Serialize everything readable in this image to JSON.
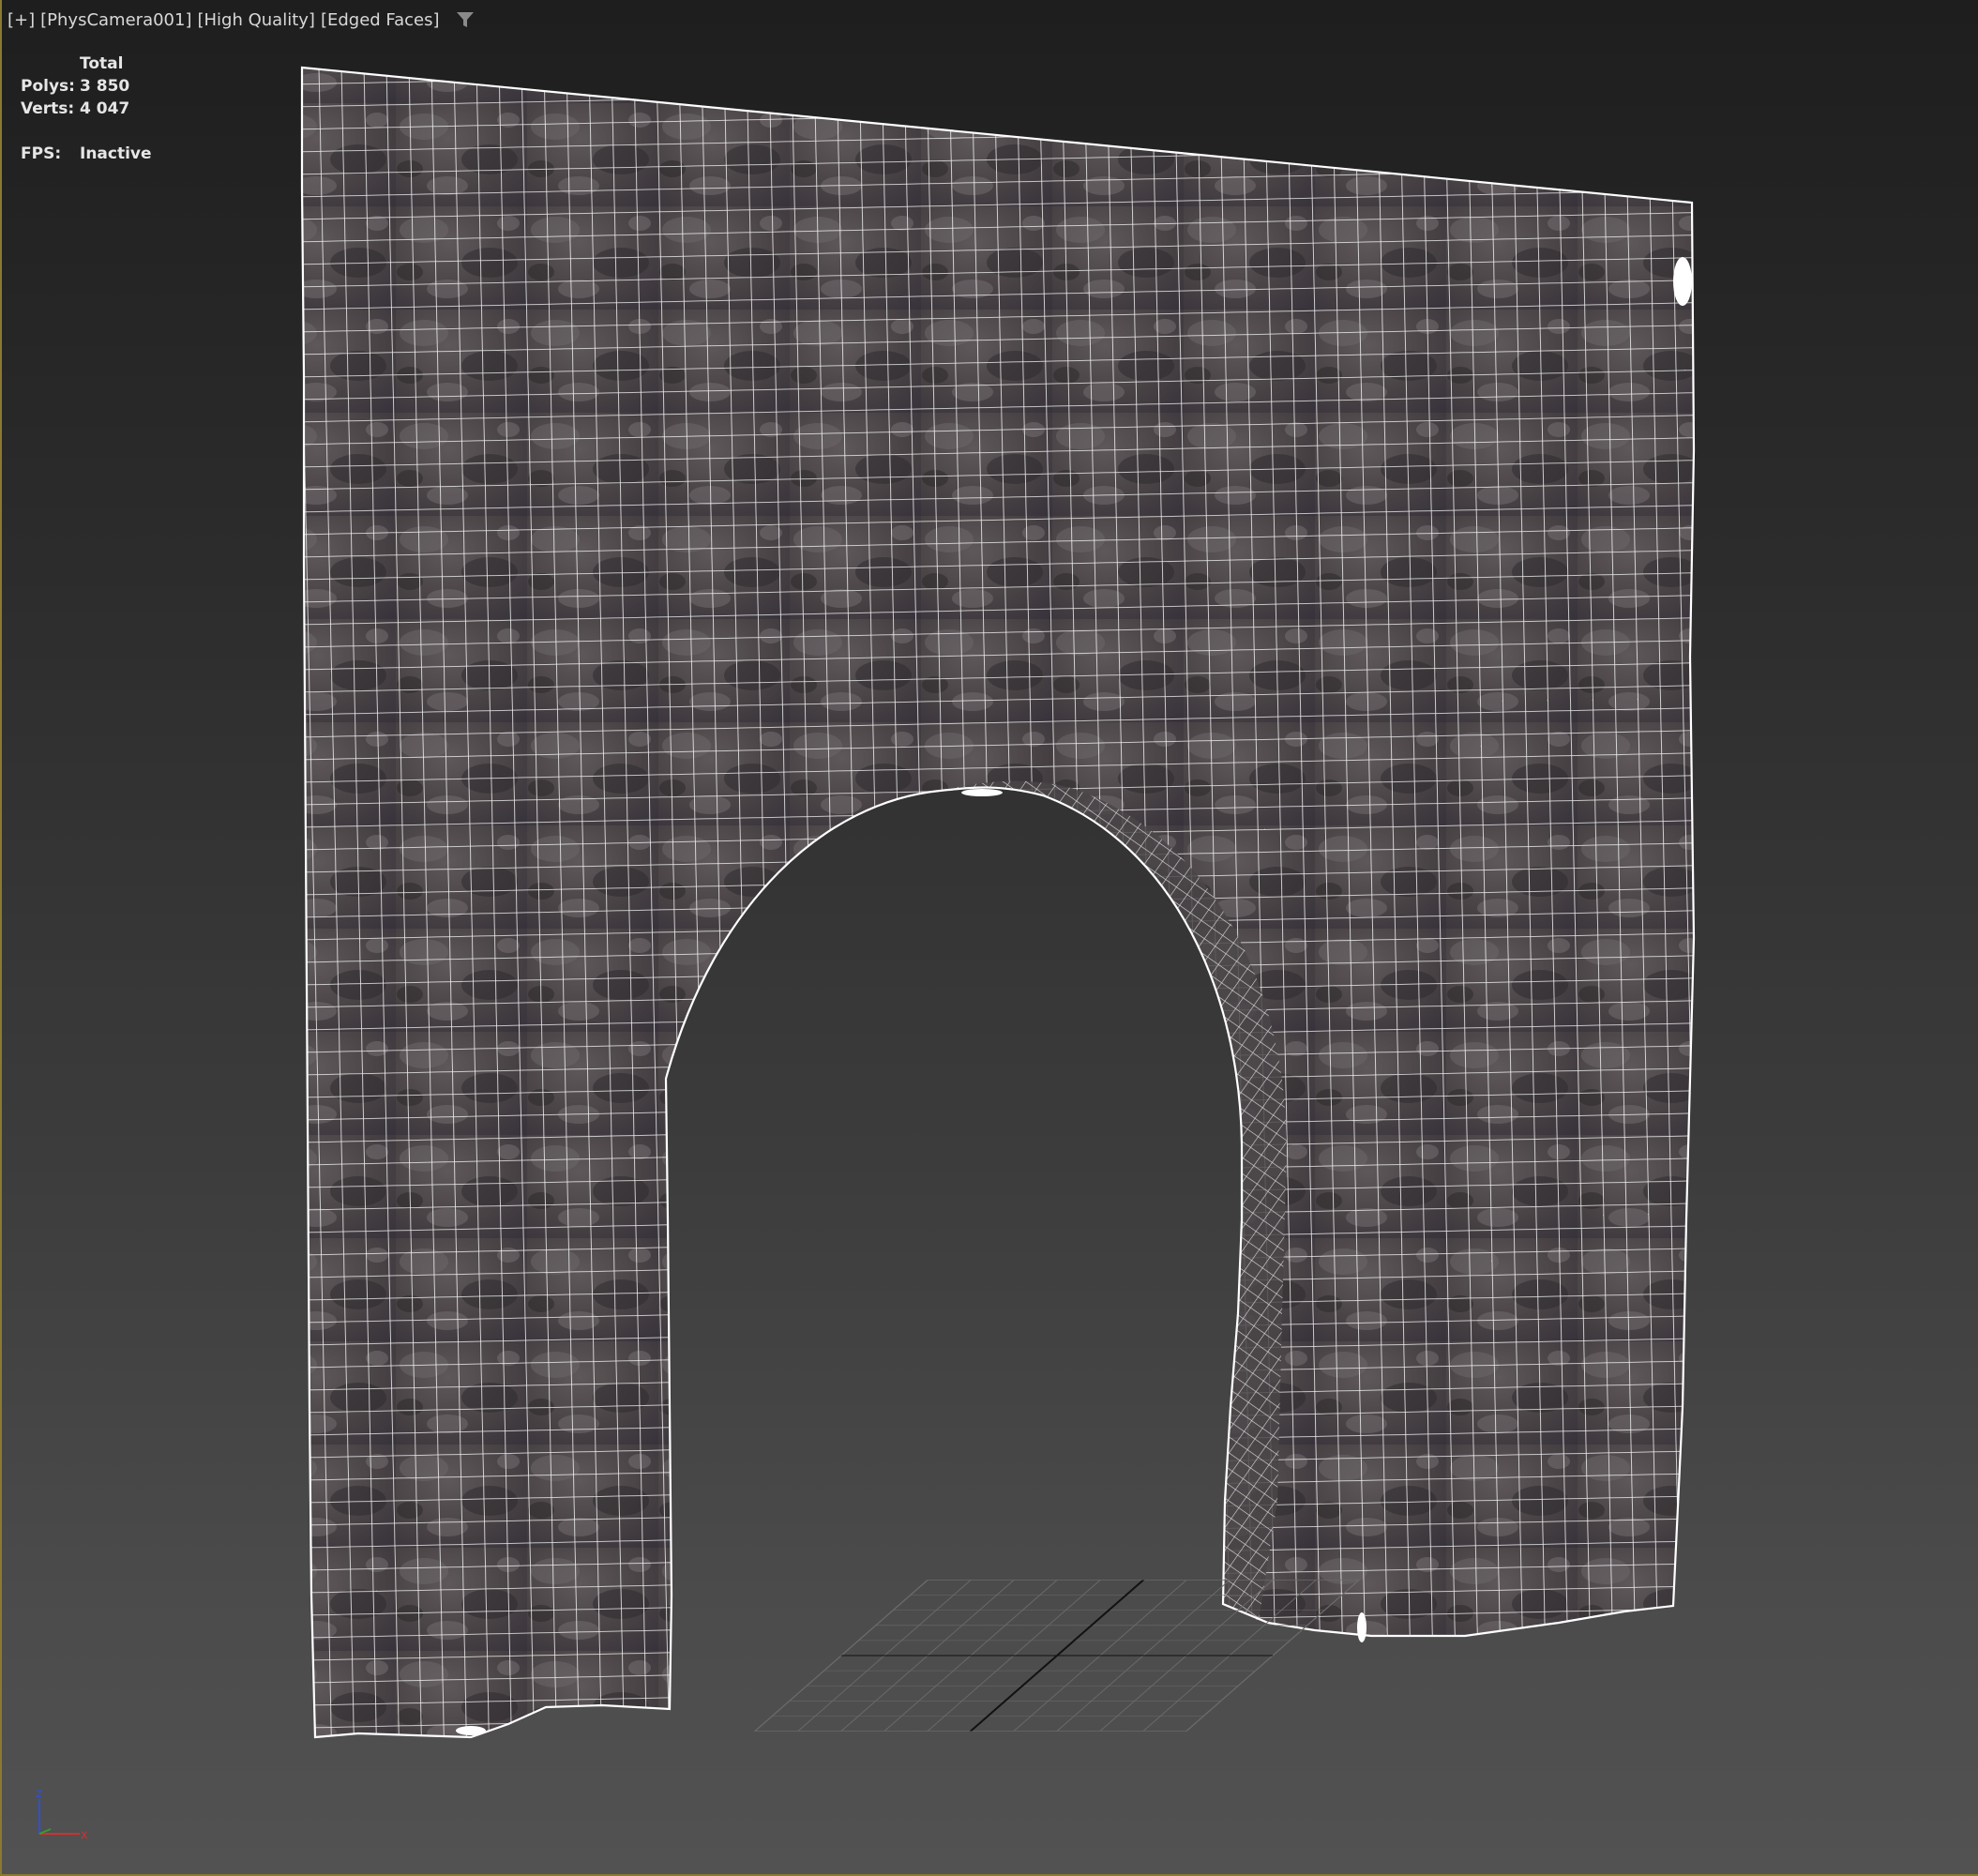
{
  "viewport": {
    "labels": [
      "[+]",
      "[PhysCamera001]",
      "[High Quality]",
      "[Edged Faces]"
    ],
    "filter_icon": "filter-funnel-icon"
  },
  "stats": {
    "column_header": "Total",
    "polys_label": "Polys:",
    "polys_value": "3 850",
    "verts_label": "Verts:",
    "verts_value": "4 047",
    "fps_label": "FPS:",
    "fps_value": "Inactive"
  },
  "gizmo": {
    "z_label": "z",
    "x_label": "x",
    "icon": "axis-tripod-icon"
  },
  "colors": {
    "wireframe": "#ffffff",
    "stone_dark": "#3b3638",
    "stone_light": "#6a6466",
    "viewport_border": "#8a7a30",
    "axis_x": "#d03030",
    "axis_y": "#30a030",
    "axis_z": "#3050d0"
  }
}
